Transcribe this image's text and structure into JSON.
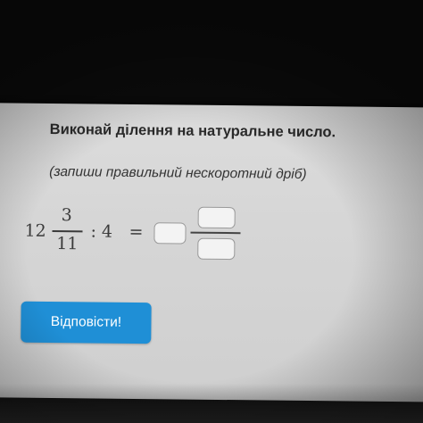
{
  "task": {
    "title": "Виконай ділення на натуральне число.",
    "hint": "(запиши правильний нескоротний дріб)"
  },
  "expression": {
    "whole": "12",
    "numerator": "3",
    "denominator": "11",
    "operator": ": 4",
    "equals": "="
  },
  "answer": {
    "whole_value": "",
    "numerator_value": "",
    "denominator_value": ""
  },
  "submit": {
    "label": "Відповісти!"
  },
  "colors": {
    "accent": "#1f8fd6",
    "page_background": "#d8d8d8",
    "text": "#2a2a2a"
  }
}
